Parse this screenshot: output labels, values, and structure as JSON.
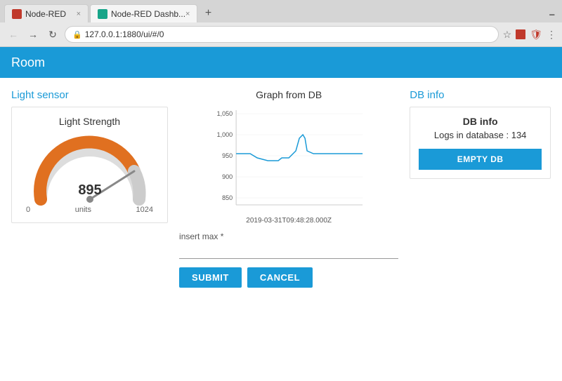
{
  "browser": {
    "tabs": [
      {
        "id": "tab1",
        "label": "Node-RED",
        "icon_color": "red",
        "active": false
      },
      {
        "id": "tab2",
        "label": "Node-RED Dashb...",
        "icon_color": "teal",
        "active": true
      }
    ],
    "new_tab_symbol": "+",
    "url": "127.0.0.1:1880/ui/#/0",
    "nav": {
      "back": "←",
      "forward": "→",
      "reload": "↻"
    },
    "star_icon": "☆",
    "menu_icon": "⋮"
  },
  "app": {
    "header": "Room",
    "light_sensor": {
      "section_title": "Light sensor",
      "gauge_title": "Light Strength",
      "value": "895",
      "min": "0",
      "max": "1024",
      "unit": "units"
    },
    "graph": {
      "title": "Graph from DB",
      "y_labels": [
        "1,050",
        "1,000",
        "950",
        "900",
        "850"
      ],
      "timestamp": "2019-03-31T09:48:28.000Z"
    },
    "form": {
      "input_label": "insert max *",
      "input_placeholder": "",
      "submit_label": "SUBMIT",
      "cancel_label": "CANCEL"
    },
    "db_info": {
      "section_title": "DB info",
      "box_title": "DB info",
      "logs_label": "Logs in database : 134",
      "empty_btn_label": "EMPTY DB"
    }
  }
}
